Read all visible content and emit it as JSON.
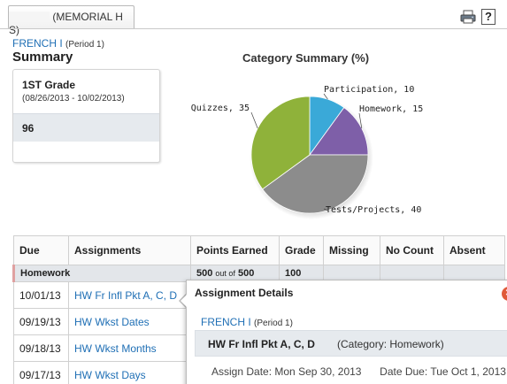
{
  "header": {
    "school_name": "(MEMORIAL H S)",
    "help_label": "?"
  },
  "course": {
    "name": "FRENCH I",
    "period": "(Period 1)"
  },
  "summary": {
    "title": "Summary",
    "grade": {
      "name": "1ST Grade",
      "dates": "(08/26/2013 - 10/02/2013)",
      "score": "96"
    }
  },
  "chart_data": {
    "type": "pie",
    "title": "Category Summary (%)",
    "slices": [
      {
        "label": "Participation, 10",
        "name": "Participation",
        "value": 10,
        "color": "#3aa9d8"
      },
      {
        "label": "Homework, 15",
        "name": "Homework",
        "value": 15,
        "color": "#7e5fa8"
      },
      {
        "label": "Tests/Projects, 40",
        "name": "Tests/Projects",
        "value": 40,
        "color": "#8c8c8c"
      },
      {
        "label": "Quizzes, 35",
        "name": "Quizzes",
        "value": 35,
        "color": "#8fb23a"
      }
    ]
  },
  "table": {
    "headers": [
      "Due",
      "Assignments",
      "Points Earned",
      "Grade",
      "Missing",
      "No Count",
      "Absent"
    ],
    "category_row": {
      "name": "Homework",
      "points": "500",
      "out_of": "out of",
      "total": "500",
      "grade": "100"
    },
    "rows": [
      {
        "due": "10/01/13",
        "assignment": "HW Fr Infl Pkt A, C, D"
      },
      {
        "due": "09/19/13",
        "assignment": "HW Wkst Dates"
      },
      {
        "due": "09/18/13",
        "assignment": "HW Wkst Months"
      },
      {
        "due": "09/17/13",
        "assignment": "HW Wkst Days"
      }
    ]
  },
  "popup": {
    "title": "Assignment Details",
    "course": "FRENCH I",
    "period": "(Period 1)",
    "assignment": "HW Fr Infl Pkt A, C, D",
    "category": "(Category: Homework)",
    "assign_date_label": "Assign Date:",
    "assign_date": "Mon Sep 30, 2013",
    "due_date_label": "Date Due:",
    "due_date": "Tue Oct 1, 2013"
  }
}
